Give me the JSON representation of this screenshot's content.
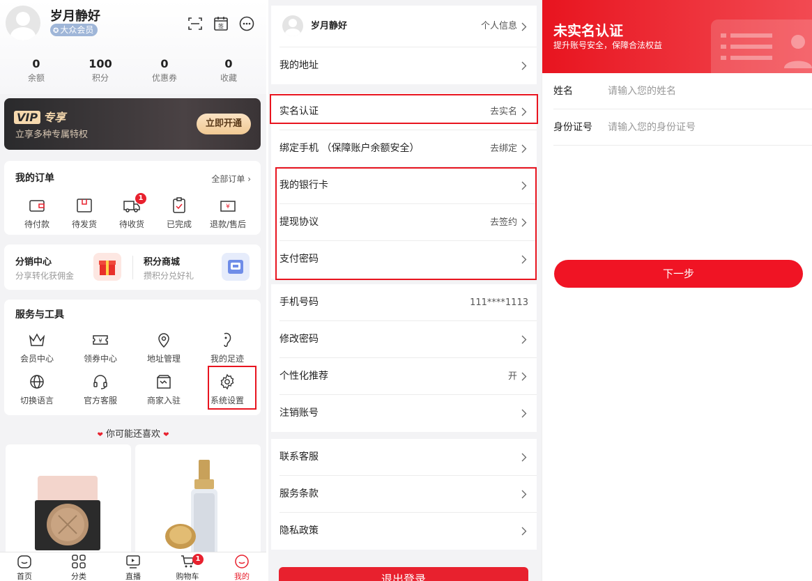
{
  "panel1": {
    "user": {
      "name": "岁月静好",
      "level": "大众会员"
    },
    "header_icons": [
      "scan-icon",
      "checkin-calendar-icon",
      "message-icon"
    ],
    "checkin_label": "签",
    "stats": [
      {
        "value": "0",
        "label": "余额"
      },
      {
        "value": "100",
        "label": "积分"
      },
      {
        "value": "0",
        "label": "优惠券"
      },
      {
        "value": "0",
        "label": "收藏"
      }
    ],
    "vip": {
      "badge": "VIP",
      "title": "专享",
      "subtitle": "立享多种专属特权",
      "button": "立即开通"
    },
    "orders": {
      "title": "我的订单",
      "more": "全部订单",
      "items": [
        {
          "label": "待付款",
          "icon": "wallet-icon"
        },
        {
          "label": "待发货",
          "icon": "package-icon"
        },
        {
          "label": "待收货",
          "icon": "truck-icon",
          "badge": "1"
        },
        {
          "label": "已完成",
          "icon": "clipboard-check-icon"
        },
        {
          "label": "退款/售后",
          "icon": "refund-icon",
          "symbol": "¥"
        }
      ]
    },
    "distribution": {
      "left": {
        "title": "分销中心",
        "subtitle": "分享转化获佣金"
      },
      "right": {
        "title": "积分商城",
        "subtitle": "攒积分兑好礼"
      }
    },
    "services": {
      "title": "服务与工具",
      "items": [
        {
          "label": "会员中心",
          "icon": "crown-icon"
        },
        {
          "label": "领券中心",
          "icon": "coupon-icon",
          "symbol": "¥"
        },
        {
          "label": "地址管理",
          "icon": "location-icon"
        },
        {
          "label": "我的足迹",
          "icon": "footprint-icon"
        },
        {
          "label": "切换语言",
          "icon": "globe-icon"
        },
        {
          "label": "官方客服",
          "icon": "headset-icon"
        },
        {
          "label": "商家入驻",
          "icon": "store-icon"
        },
        {
          "label": "系统设置",
          "icon": "gear-icon"
        }
      ]
    },
    "recommend_title": "你可能还喜欢",
    "tabs": [
      {
        "label": "首页",
        "icon": "home-icon"
      },
      {
        "label": "分类",
        "icon": "category-icon"
      },
      {
        "label": "直播",
        "icon": "live-icon"
      },
      {
        "label": "购物车",
        "icon": "cart-icon",
        "badge": "1"
      },
      {
        "label": "我的",
        "icon": "profile-icon",
        "active": true
      }
    ],
    "colors": {
      "accent": "#e8212e",
      "vip_gold": "#f6d9ae",
      "badge_blue": "#9fb6d8"
    }
  },
  "panel2": {
    "profile": {
      "name": "岁月静好",
      "action": "个人信息"
    },
    "rows": [
      {
        "key": "address",
        "label": "我的地址",
        "value": ""
      },
      {
        "key": "realname",
        "label": "实名认证",
        "value": "去实名"
      },
      {
        "key": "bind-phone",
        "label": "绑定手机 （保障账户余额安全）",
        "value": "去绑定"
      },
      {
        "key": "bank-card",
        "label": "我的银行卡",
        "value": ""
      },
      {
        "key": "withdraw-agreement",
        "label": "提现协议",
        "value": "去签约"
      },
      {
        "key": "pay-password",
        "label": "支付密码",
        "value": ""
      },
      {
        "key": "phone-number",
        "label": "手机号码",
        "value": "111****1113"
      },
      {
        "key": "change-password",
        "label": "修改密码",
        "value": ""
      },
      {
        "key": "personalization",
        "label": "个性化推荐",
        "value": "开"
      },
      {
        "key": "cancel-account",
        "label": "注销账号",
        "value": ""
      },
      {
        "key": "contact-service",
        "label": "联系客服",
        "value": ""
      },
      {
        "key": "service-terms",
        "label": "服务条款",
        "value": ""
      },
      {
        "key": "privacy-policy",
        "label": "隐私政策",
        "value": ""
      }
    ],
    "logout": "退出登录"
  },
  "panel3": {
    "title": "未实名认证",
    "subtitle": "提升账号安全，保障合法权益",
    "fields": [
      {
        "label": "姓名",
        "placeholder": "请输入您的姓名"
      },
      {
        "label": "身份证号",
        "placeholder": "请输入您的身份证号"
      }
    ],
    "next_button": "下一步",
    "colors": {
      "primary": "#f01424"
    }
  }
}
